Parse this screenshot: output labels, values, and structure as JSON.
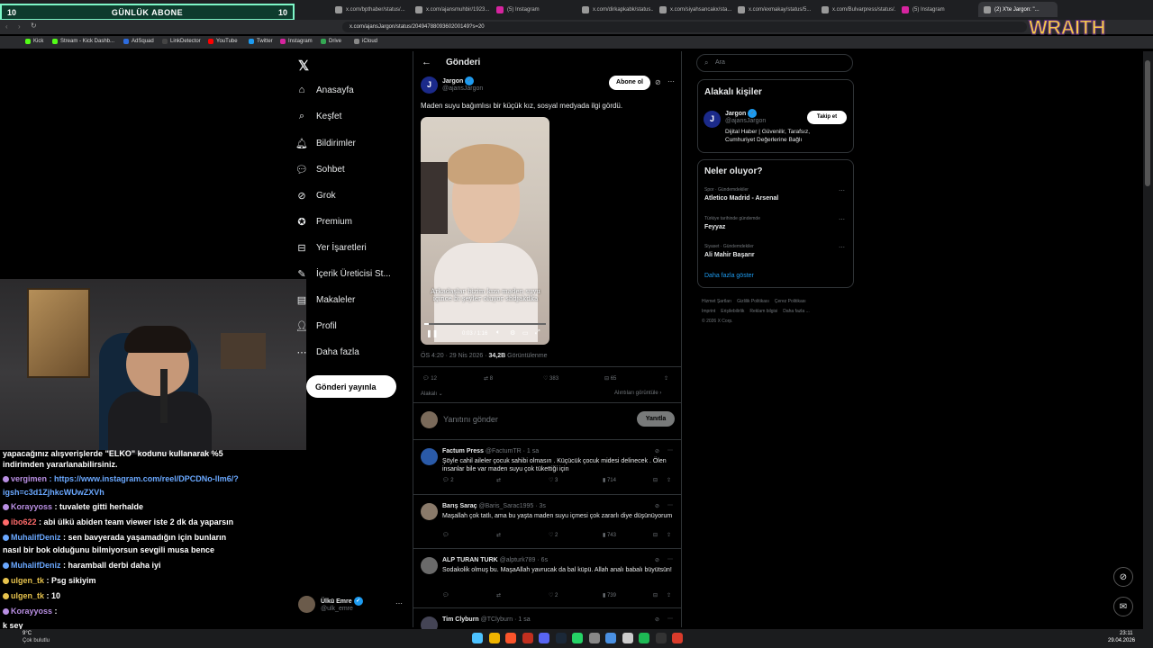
{
  "overlay": {
    "left": "10",
    "title": "GÜNLÜK ABONE",
    "right": "10"
  },
  "browser": {
    "tabs": [
      {
        "label": "x.com/bpthaber/status/..."
      },
      {
        "label": "x.com/ajansmuhbir/1923..."
      },
      {
        "label": "(5) Instagram"
      },
      {
        "label": "x.com/dirkapkabk/status..."
      },
      {
        "label": "x.com/siyahsancakx/sta..."
      },
      {
        "label": "x.com/exmakay/status/5..."
      },
      {
        "label": "x.com/Bulvarpress/status/..."
      },
      {
        "label": "(5) Instagram"
      },
      {
        "label": "(2) X'te Jargon: \"..."
      }
    ],
    "url": "x.com/ajansJargon/status/2049478809360200149?s=20",
    "bookmarks": [
      "Kick",
      "Stream - Kick Dashb...",
      "AdSquad",
      "LinkDetector",
      "YouTube",
      "Twitter",
      "Instagram",
      "Drive",
      "iCloud"
    ],
    "brand": "WRAITH"
  },
  "x": {
    "nav": [
      "Anasayfa",
      "Keşfet",
      "Bildirimler",
      "Sohbet",
      "Grok",
      "Premium",
      "Yer İşaretleri",
      "İçerik Üreticisi St...",
      "Makaleler",
      "Profil",
      "Daha fazla"
    ],
    "post_button": "Gönderi yayınla",
    "profile": {
      "name": "Ülkü Emre",
      "handle": "@ulk_emre"
    },
    "header": "Gönderi",
    "post": {
      "author": "Jargon",
      "handle": "@ajansJargon",
      "follow": "Abone ol",
      "text": "Maden suyu bağımlısı bir küçük kız, sosyal medyada ilgi gördü.",
      "caption": "Arkadaşlar bizim kıza maden suyu içince bi şeyler oluyor shdjakdka",
      "video_time": "0:03 / 1:16",
      "meta": "ÖS 4:20 · 29 Nis 2026 · ",
      "views": "34,2B",
      "views_label": "Görüntülenme",
      "replies": "12",
      "reposts": "8",
      "likes": "383",
      "bookmarks": "65",
      "related": "Alakalı",
      "quotes": "Alıntıları görüntüle",
      "reply_placeholder": "Yanıtını gönder",
      "reply_btn": "Yanıtla"
    },
    "replies": [
      {
        "name": "Factum Press",
        "handle": "@FactumTR · 1 sa",
        "text": "Şöyle cahil aileler çocuk sahibi olmasın . Küçücük çocuk midesi delinecek . Ölen insanlar bile var maden suyu çok tükettiği için",
        "c": "2",
        "r": "",
        "l": "3",
        "v": "714"
      },
      {
        "name": "Barış Saraç",
        "handle": "@Baris_Sarac1995 · 3s",
        "text": "Maşallah çok tatlı, ama bu yaşta maden suyu içmesi çok zararlı diye düşünüyorum",
        "c": "",
        "r": "",
        "l": "2",
        "v": "743"
      },
      {
        "name": "ALP TURAN TURK",
        "handle": "@alpturk789 · 6s",
        "text": "Sodakolik olmuş bu. MaşaAllah yavrucak da bal küpü. Allah analı babalı büyütsün!",
        "c": "",
        "r": "",
        "l": "2",
        "v": "739"
      },
      {
        "name": "Tim Clyburn",
        "handle": "@TClyburn · 1 sa",
        "text": "",
        "c": "",
        "r": "",
        "l": "",
        "v": ""
      }
    ],
    "search_placeholder": "Ara",
    "who_title": "Alakalı kişiler",
    "who": {
      "name": "Jargon",
      "handle": "@ajansJargon",
      "btn": "Takip et",
      "bio": "Dijital Haber | Güvenilir, Tarafsız, Cumhuriyet Değerlerine Bağlı"
    },
    "trends_title": "Neler oluyor?",
    "trends": [
      {
        "cat": "Spor · Gündemdekiler",
        "title": "Atletico Madrid - Arsenal"
      },
      {
        "cat": "Türkiye tarihinde gündemde",
        "title": "Feyyaz"
      },
      {
        "cat": "Siyaset · Gündemdekiler",
        "title": "Ali Mahir Başarır"
      }
    ],
    "show_more": "Daha fazla göster",
    "footer": [
      "Hizmet Şartları",
      "Gizlilik Politikası",
      "Çerez Politikası",
      "Imprint",
      "Erişilebilirlik",
      "Reklam bilgisi",
      "Daha fazla ...",
      "© 2026 X Corp."
    ]
  },
  "chat": [
    {
      "user": "",
      "text": "yapacağınız alışverişlerde \"ELKO\" kodunu kullanarak %5",
      "color": ""
    },
    {
      "user": "",
      "text": "indirimden yararlanabilirsiniz.",
      "color": ""
    },
    {
      "user": "vergimen",
      "text": ": https://www.instagram.com/reel/DPCDNo-llm6/?",
      "color": "#b98fe3"
    },
    {
      "user": "",
      "text": "igsh=c3d1ZjhkcWUwZXVh",
      "color": ""
    },
    {
      "user": "Korayyoss",
      "text": ": tuvalete gitti herhalde",
      "color": "#b98fe3"
    },
    {
      "user": "ibo622",
      "text": ": abi ülkü abiden team viewer iste 2 dk da yaparsın",
      "color": "#ff6b6b"
    },
    {
      "user": "MuhalifDeniz",
      "text": ": sen bavyerada yaşamadığın için bunların",
      "color": "#6aa8ff"
    },
    {
      "user": "",
      "text": "nasıl bir bok olduğunu bilmiyorsun sevgili musa bence",
      "color": ""
    },
    {
      "user": "MuhalifDeniz",
      "text": ": haramball derbi daha iyi",
      "color": "#6aa8ff"
    },
    {
      "user": "ulgen_tk",
      "text": ": Psg sikiyim",
      "color": "#e7c34d"
    },
    {
      "user": "ulgen_tk",
      "text": ": 10",
      "color": "#e7c34d"
    },
    {
      "user": "Korayyoss",
      "text": ":",
      "color": "#b98fe3"
    },
    {
      "user": "",
      "text": "k sey",
      "color": ""
    }
  ],
  "taskbar": {
    "weather": "9°C",
    "weather_desc": "Çok bulutlu",
    "time": "23:11",
    "date": "29.04.2026"
  }
}
